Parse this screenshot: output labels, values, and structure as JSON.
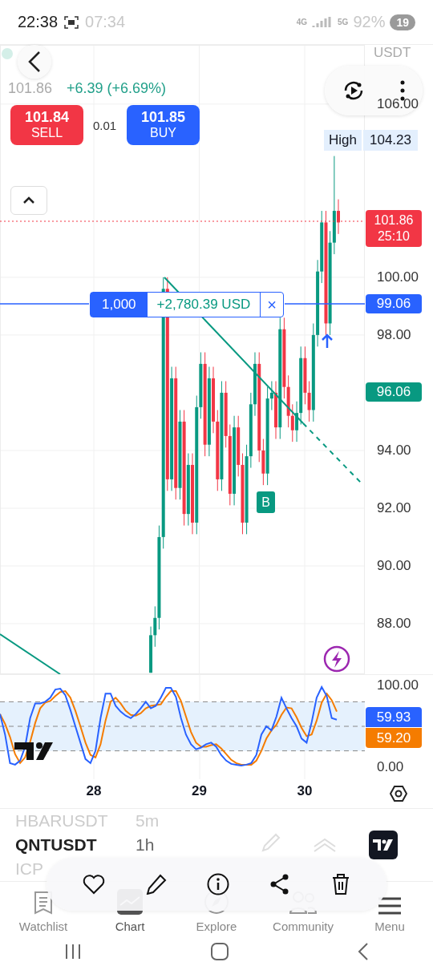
{
  "status_bar": {
    "time": "22:38",
    "ghost_time": "07:34",
    "network_4g": "4G",
    "network_5g": "5G",
    "battery": "19",
    "ghost_battery": "92%"
  },
  "header": {
    "last_price": "101.86",
    "change": "+6.39 (+6.69%)",
    "currency": "USDT",
    "sell": {
      "price": "101.84",
      "label": "SELL"
    },
    "spread": "0.01",
    "buy": {
      "price": "101.85",
      "label": "BUY"
    }
  },
  "chart": {
    "chart_data": {
      "type": "candlestick",
      "ylim": [
        86.25,
        108.05
      ],
      "yticks": [
        {
          "value": 106,
          "label": "106.00"
        },
        {
          "value": 100,
          "label": "100.00"
        },
        {
          "value": 98,
          "label": "98.00"
        },
        {
          "value": 94,
          "label": "94.00"
        },
        {
          "value": 92,
          "label": "92.00"
        },
        {
          "value": 90,
          "label": "90.00"
        },
        {
          "value": 88,
          "label": "88.00"
        }
      ],
      "xlim": [
        27.11,
        30.57
      ],
      "grid": true,
      "xticks": [
        {
          "value": 28,
          "label": "28"
        },
        {
          "value": 29,
          "label": "29"
        },
        {
          "value": 30,
          "label": "30"
        }
      ],
      "x": [
        28.54,
        28.58,
        28.619,
        28.659,
        28.698,
        28.738,
        28.777,
        28.817,
        28.856,
        28.896,
        28.935,
        28.975,
        29.014,
        29.054,
        29.094,
        29.133,
        29.173,
        29.212,
        29.252,
        29.291,
        29.331,
        29.37,
        29.41,
        29.449,
        29.489,
        29.528,
        29.568,
        29.607,
        29.647,
        29.687,
        29.726,
        29.766,
        29.805,
        29.845,
        29.884,
        29.924,
        29.963,
        30.003,
        30.042,
        30.082,
        30.122,
        30.161,
        30.201,
        30.24,
        30.28,
        30.319
      ],
      "ohlc": [
        [
          86.3,
          87.9,
          86.3,
          87.6
        ],
        [
          87.6,
          88.6,
          87.2,
          88.2
        ],
        [
          88.2,
          91.4,
          87.8,
          91
        ],
        [
          91,
          100,
          90.6,
          99.6
        ],
        [
          99.6,
          100,
          92.6,
          93
        ],
        [
          93,
          96.9,
          92.6,
          96.5
        ],
        [
          96.5,
          96.9,
          92.3,
          92.7
        ],
        [
          92.7,
          95.4,
          92.3,
          95
        ],
        [
          95,
          95.4,
          91.4,
          91.8
        ],
        [
          91.8,
          93.9,
          91.4,
          93.5
        ],
        [
          93.5,
          93.9,
          91.1,
          91.5
        ],
        [
          91.5,
          95.9,
          91.1,
          95.5
        ],
        [
          95.5,
          97.4,
          95.1,
          97
        ],
        [
          97,
          97.4,
          93.8,
          94.2
        ],
        [
          94.2,
          96.9,
          93.8,
          96.5
        ],
        [
          96.5,
          96.9,
          94.6,
          95
        ],
        [
          95,
          95.4,
          92.6,
          93
        ],
        [
          93,
          96.4,
          92.6,
          96
        ],
        [
          96,
          96.4,
          94.1,
          94.5
        ],
        [
          94.5,
          94.9,
          92.1,
          92.5
        ],
        [
          92.5,
          95.2,
          92.1,
          94.8
        ],
        [
          94.8,
          95.2,
          93.1,
          93.5
        ],
        [
          93.5,
          93.9,
          91.1,
          91.5
        ],
        [
          91.5,
          94.2,
          91.1,
          93.8
        ],
        [
          93.8,
          96,
          93.4,
          95.6
        ],
        [
          95.6,
          97.4,
          95.2,
          97
        ],
        [
          97,
          97.4,
          93.6,
          94
        ],
        [
          94,
          94.4,
          92.8,
          93.2
        ],
        [
          93.2,
          96.2,
          92.8,
          95.8
        ],
        [
          95.8,
          96.4,
          95.4,
          96
        ],
        [
          96,
          96.4,
          94.4,
          94.8
        ],
        [
          94.8,
          98.6,
          94.4,
          98.2
        ],
        [
          98.2,
          98.6,
          95.8,
          96.2
        ],
        [
          96.2,
          96.6,
          94.8,
          95.2
        ],
        [
          95.2,
          95.6,
          94.3,
          94.7
        ],
        [
          94.7,
          95.7,
          94.3,
          95.3
        ],
        [
          95.3,
          97.6,
          94.9,
          97.2
        ],
        [
          97.2,
          97.6,
          95.6,
          96
        ],
        [
          96,
          96.4,
          95,
          95.4
        ],
        [
          95.4,
          98.4,
          95,
          98
        ],
        [
          98,
          100.6,
          97.6,
          100.2
        ],
        [
          100.2,
          102.3,
          99.8,
          101.9
        ],
        [
          101.9,
          102.3,
          98,
          98.4
        ],
        [
          98.4,
          101.6,
          98,
          101.2
        ],
        [
          101.2,
          104.2,
          100.8,
          102.3
        ],
        [
          102.3,
          102.7,
          101.5,
          101.9
        ]
      ]
    },
    "high": {
      "label": "High",
      "value": "104.23"
    },
    "last": {
      "price": "101.86",
      "countdown": "25:10"
    },
    "position": {
      "quantity": "1,000",
      "pnl": "+2,780.39 USD",
      "close": "×",
      "price": "99.06"
    },
    "alert_price": "96.06",
    "trade_marker": "B"
  },
  "oscillator": {
    "k_value": "59.93",
    "d_value": "59.20",
    "chart_data": {
      "type": "line",
      "ylim": [
        0,
        100
      ],
      "yticks": [
        {
          "value": 100,
          "label": "100.00"
        },
        {
          "value": 0,
          "label": "0.00"
        }
      ],
      "series": [
        {
          "color": "#2962ff",
          "values": [
            65,
            40,
            5,
            3,
            8,
            25,
            60,
            78,
            78,
            80,
            85,
            95,
            96,
            88,
            70,
            50,
            30,
            10,
            5,
            20,
            60,
            90,
            90,
            75,
            68,
            63,
            60,
            65,
            72,
            80,
            72,
            75,
            85,
            97,
            97,
            86,
            60,
            40,
            28,
            22,
            24,
            28,
            30,
            25,
            15,
            8,
            4,
            3,
            2,
            3,
            5,
            15,
            40,
            50,
            45,
            62,
            85,
            72,
            60,
            50,
            35,
            30,
            55,
            85,
            98,
            87,
            60,
            58
          ]
        },
        {
          "color": "#f57c00",
          "values": [
            65,
            53,
            37,
            16,
            5,
            12,
            31,
            54,
            72,
            79,
            81,
            87,
            92,
            93,
            85,
            69,
            50,
            30,
            15,
            12,
            28,
            57,
            80,
            85,
            78,
            69,
            64,
            63,
            66,
            72,
            75,
            76,
            77,
            86,
            93,
            93,
            81,
            62,
            43,
            30,
            25,
            25,
            27,
            28,
            23,
            16,
            9,
            5,
            3,
            3,
            3,
            8,
            20,
            35,
            45,
            52,
            64,
            73,
            72,
            61,
            48,
            38,
            40,
            57,
            79,
            90,
            82,
            68
          ]
        }
      ]
    }
  },
  "watchlist": [
    {
      "symbol": "HBARUSDT",
      "interval": "5m",
      "selected": false
    },
    {
      "symbol": "QNTUSDT",
      "interval": "1h",
      "selected": true
    },
    {
      "symbol": "ICP",
      "selected": false
    }
  ],
  "nav": [
    {
      "label": "Watchlist",
      "selected": false
    },
    {
      "label": "Chart",
      "selected": true
    },
    {
      "label": "Explore",
      "selected": false
    },
    {
      "label": "Community",
      "selected": false
    },
    {
      "label": "Menu",
      "selected": false
    }
  ]
}
